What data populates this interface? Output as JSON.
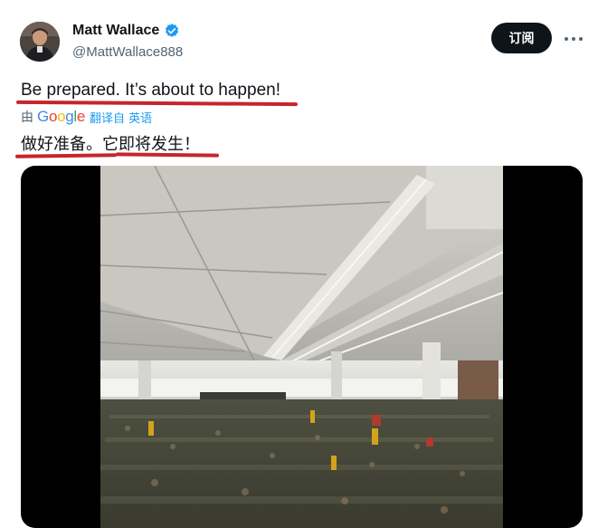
{
  "author": {
    "display_name": "Matt Wallace",
    "handle": "@MattWallace888",
    "verified": true,
    "verified_color": "#1d9bf0"
  },
  "actions": {
    "subscribe_label": "订阅",
    "more_icon": "more-horizontal-icon"
  },
  "tweet": {
    "text": "Be prepared. It’s about to happen!",
    "translation": {
      "by_label": "由",
      "provider": "Google",
      "translated_from_label": "翻译自 英语",
      "text": "做好准备。它即将发生！"
    },
    "media": {
      "type": "video",
      "icon": "video-icon"
    }
  },
  "colors": {
    "underline_annotation": "#c6252b",
    "button_bg": "#0f1419",
    "link_blue": "#1d9bf0"
  }
}
